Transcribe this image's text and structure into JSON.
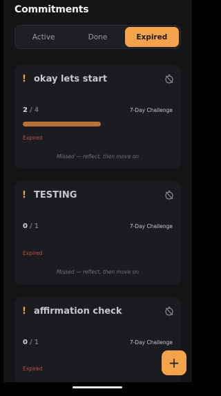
{
  "header": {
    "title": "Commitments"
  },
  "tabs": [
    {
      "label": "Active"
    },
    {
      "label": "Done"
    },
    {
      "label": "Expired"
    }
  ],
  "cards": [
    {
      "title": "okay lets start",
      "done": "2",
      "total": "/ 4",
      "challenge": "7-Day Challenge",
      "status": "Expired",
      "note": "Missed — reflect, then move on",
      "progress": 0.5
    },
    {
      "title": "TESTING",
      "done": "0",
      "total": "/ 1",
      "challenge": "7-Day Challenge",
      "status": "Expired",
      "note": "Missed — reflect, then move on",
      "progress": 0
    },
    {
      "title": "affirmation check",
      "done": "0",
      "total": "/ 1",
      "challenge": "7-Day Challenge",
      "status": "Expired",
      "note": "",
      "progress": 0
    }
  ],
  "fab": {
    "label": "+"
  },
  "icons": {
    "warning": "exclamation-icon",
    "timer": "timer-off-icon"
  },
  "colors": {
    "accent": "#f4a24c",
    "progress": "#b9733a",
    "expired": "#c0504d"
  }
}
